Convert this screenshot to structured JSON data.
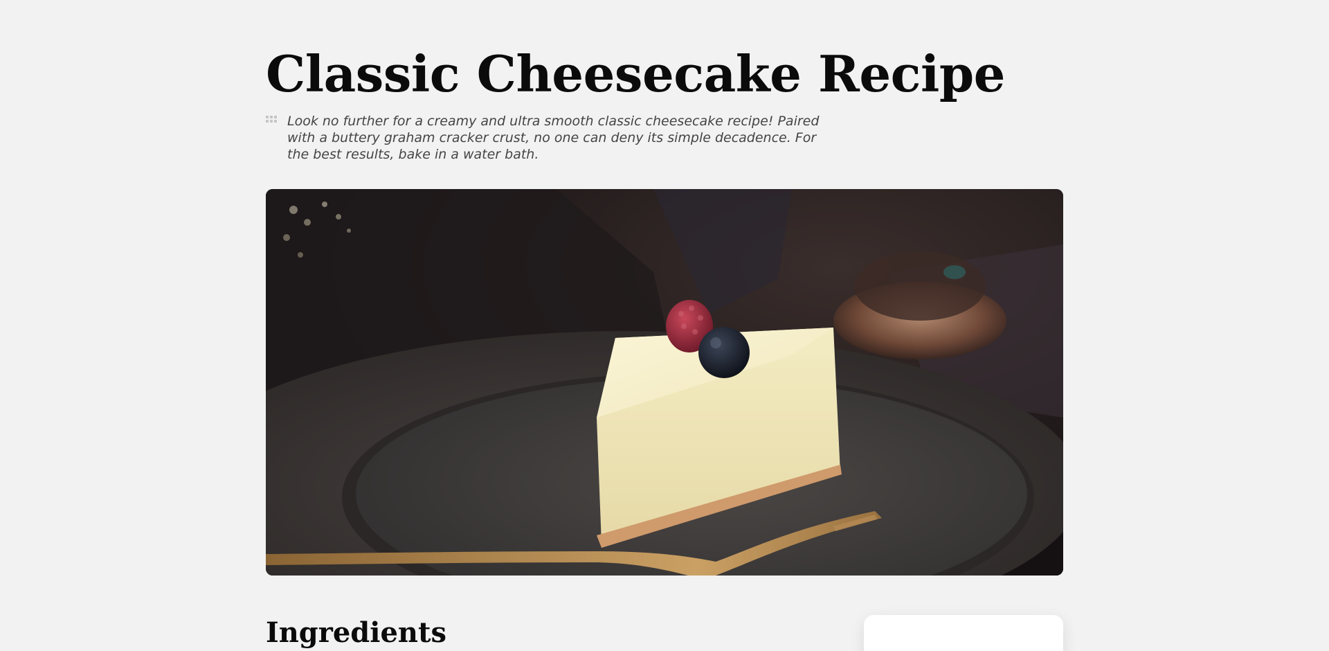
{
  "recipe": {
    "title": "Classic Cheesecake Recipe",
    "description": "Look no further for a creamy and ultra smooth classic cheesecake recipe! Paired with a buttery graham cracker crust, no one can deny its simple decadence. For the best results, bake in a water bath.",
    "drag_handle_icon": "drag-handle-icon"
  },
  "sections": {
    "ingredients_heading": "Ingredients"
  },
  "colors": {
    "background": "#f2f2f2",
    "title": "#0b0b0b",
    "body_text": "#444444",
    "card": "#ffffff"
  }
}
